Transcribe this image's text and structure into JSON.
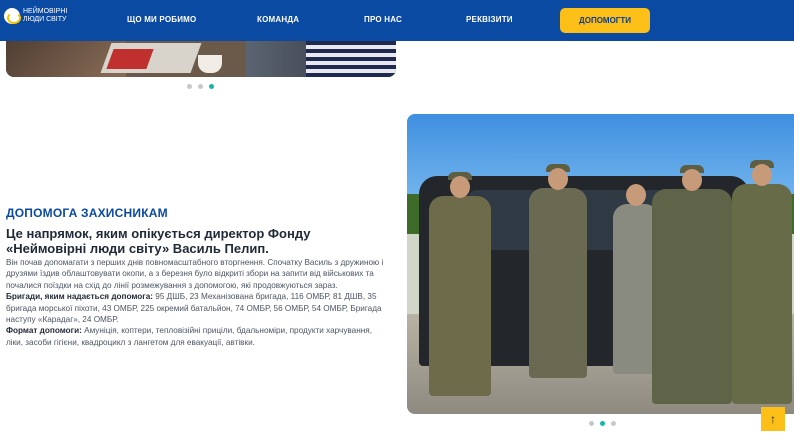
{
  "header": {
    "logo_line1": "НЕЙМОВІРНІ",
    "logo_line2": "ЛЮДИ СВІТУ",
    "nav": [
      "ЩО МИ РОБИМО",
      "КОМАНДА",
      "ПРО НАС",
      "РЕКВІЗИТИ"
    ],
    "donate_label": "ДОПОМОГТИ"
  },
  "section": {
    "title": "ДОПОМОГА ЗАХИСНИКАМ",
    "headline": "Це напрямок, яким опікується директор Фонду «Неймовірні люди світу» Василь Пелип.",
    "paragraph": "Він почав допомагати з перших днів повномасштабного вторгнення. Спочатку Василь з дружиною і друзями їздив облаштовувати окопи, а з березня було відкриті збори на запити від військових та почалися поїздки на схід до лінії розмежування з допомогою, які продовжуються зараз.",
    "brigades_label": "Бригади, яким надається допомога:",
    "brigades_text": " 95 ДШБ, 23 Механізована бригада, 116 ОМБР, 81 ДШВ, 35 бригада морської піхоти, 43 ОМБР, 225 окремий батальйон, 74 ОМБР, 56 ОМБР, 54 ОМБР, Бригада наступу «Карадаг», 24 ОМБР.",
    "format_label": "Формат допомоги:",
    "format_text": " Амуніція, коптери, тепловізійні приціли, бдальноміри, продукти харчування, ліки, засоби гігієни, квадроцикл з лангетом для евакуації, автівки."
  },
  "carousel_top": {
    "dots": 3,
    "active": 2
  },
  "carousel_main": {
    "dots": 3,
    "active": 1
  },
  "to_top_icon": "arrow-up-icon",
  "colors": {
    "header": "#0b4aa2",
    "accent": "#fbbf17",
    "dot_active": "#14b8a6"
  }
}
